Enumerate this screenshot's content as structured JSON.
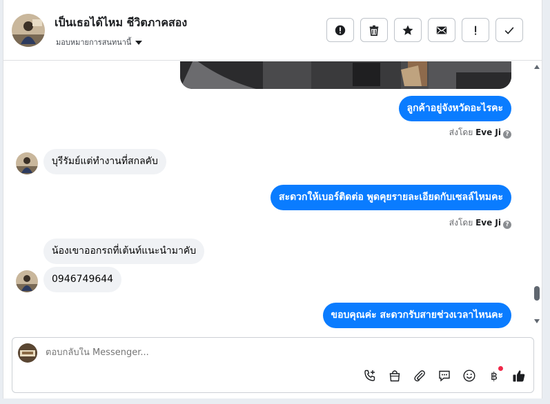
{
  "header": {
    "title": "เป็นเธอได้ไหม ชีวิตภาคสอง",
    "assign_label": "มอบหมายการสนทนานี้"
  },
  "actions": [
    {
      "name": "spam-button",
      "icon": "alert-icon"
    },
    {
      "name": "delete-button",
      "icon": "trash-icon"
    },
    {
      "name": "star-button",
      "icon": "star-icon"
    },
    {
      "name": "mark-unread-button",
      "icon": "envelope-icon"
    },
    {
      "name": "follow-up-button",
      "icon": "exclamation-icon"
    },
    {
      "name": "mark-done-button",
      "icon": "check-icon"
    }
  ],
  "thread": {
    "messages": [
      {
        "direction": "out",
        "text": "ลูกค้าอยู่จังหวัดอะไรคะ"
      },
      {
        "direction": "in",
        "text": "บุรีรัมย์แต่ทำงานที่สกลคับ"
      },
      {
        "direction": "out",
        "text": "สะดวกให้เบอร์ติดต่อ พูดคุยรายละเอียดกับเซลล์ไหมคะ"
      },
      {
        "direction": "in",
        "text": "น้องเขาออกรถที่เต้นท์แนะนำมาคับ"
      },
      {
        "direction": "in",
        "text": "0946749644"
      },
      {
        "direction": "out",
        "text": "ขอบคุณค่ะ สะดวกรับสายช่วงเวลาไหนคะ"
      }
    ],
    "sent_by_prefix": "ส่งโดย",
    "sent_by_name": "Eve Ji",
    "info_glyph": "?"
  },
  "composer": {
    "placeholder": "ตอบกลับใน Messenger...",
    "tools": [
      "phone-plus-icon",
      "shopping-bag-icon",
      "paperclip-icon",
      "chat-bubble-icon",
      "smiley-icon",
      "baht-icon",
      "thumbs-up-icon"
    ],
    "baht_glyph": "฿"
  },
  "colors": {
    "outgoing_bubble": "#0a7cff",
    "incoming_bubble": "#f0f2f5",
    "notification_dot": "#f02849"
  }
}
